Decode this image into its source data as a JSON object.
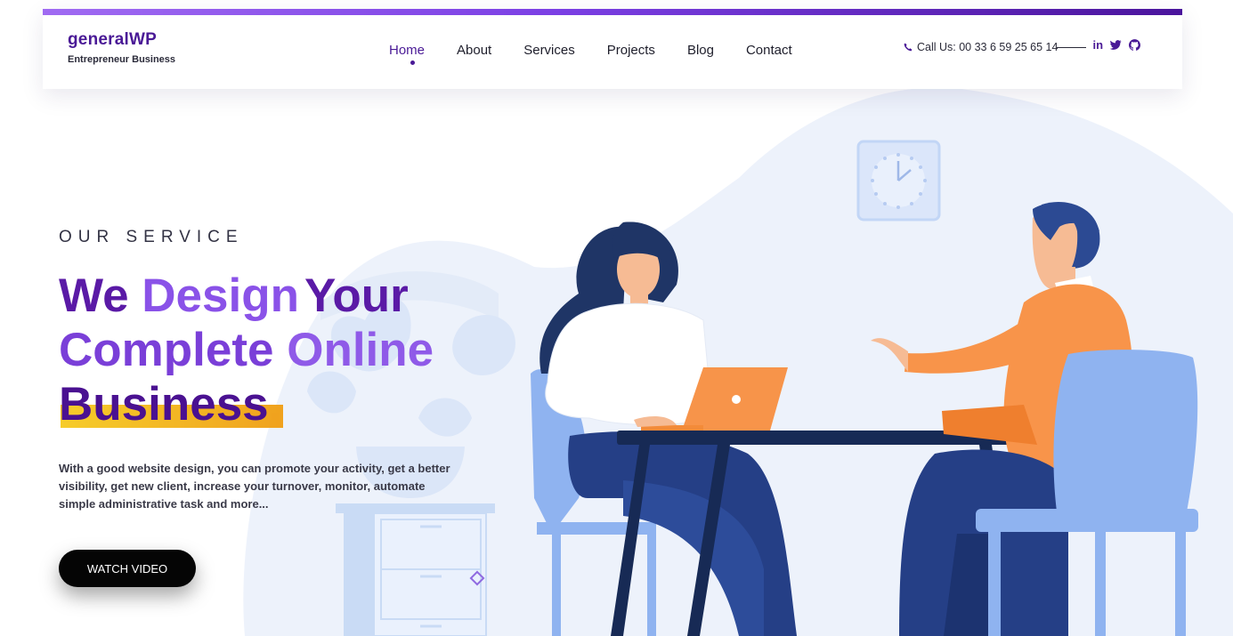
{
  "header": {
    "brand_name": "generalWP",
    "brand_tagline": "Entrepreneur Business",
    "nav": [
      "Home",
      "About",
      "Services",
      "Projects",
      "Blog",
      "Contact"
    ],
    "active_nav": "Home",
    "call_text": "Call Us: 00 33 6 59 25 65 14",
    "phone_icon": "phone-icon",
    "social": [
      "linkedin-icon",
      "twitter-icon",
      "github-icon"
    ],
    "linkedin_label": "in",
    "accent_color": "#4a1a96"
  },
  "hero": {
    "eyebrow": "OUR SERVICE",
    "headline_parts": [
      "We",
      "Design",
      "Your",
      "Complete",
      "Online",
      "Business",
      "."
    ],
    "description": "With a good website design, you can promote your activity, get a better visibility, get new client, increase your turnover, monitor, automate simple administrative task and more...",
    "button_label": "WATCH VIDEO",
    "highlight_colors": [
      "#f6cc2a",
      "#f0a21e"
    ],
    "heading_colors": [
      "#5a1aa6",
      "#8a52e8"
    ]
  }
}
